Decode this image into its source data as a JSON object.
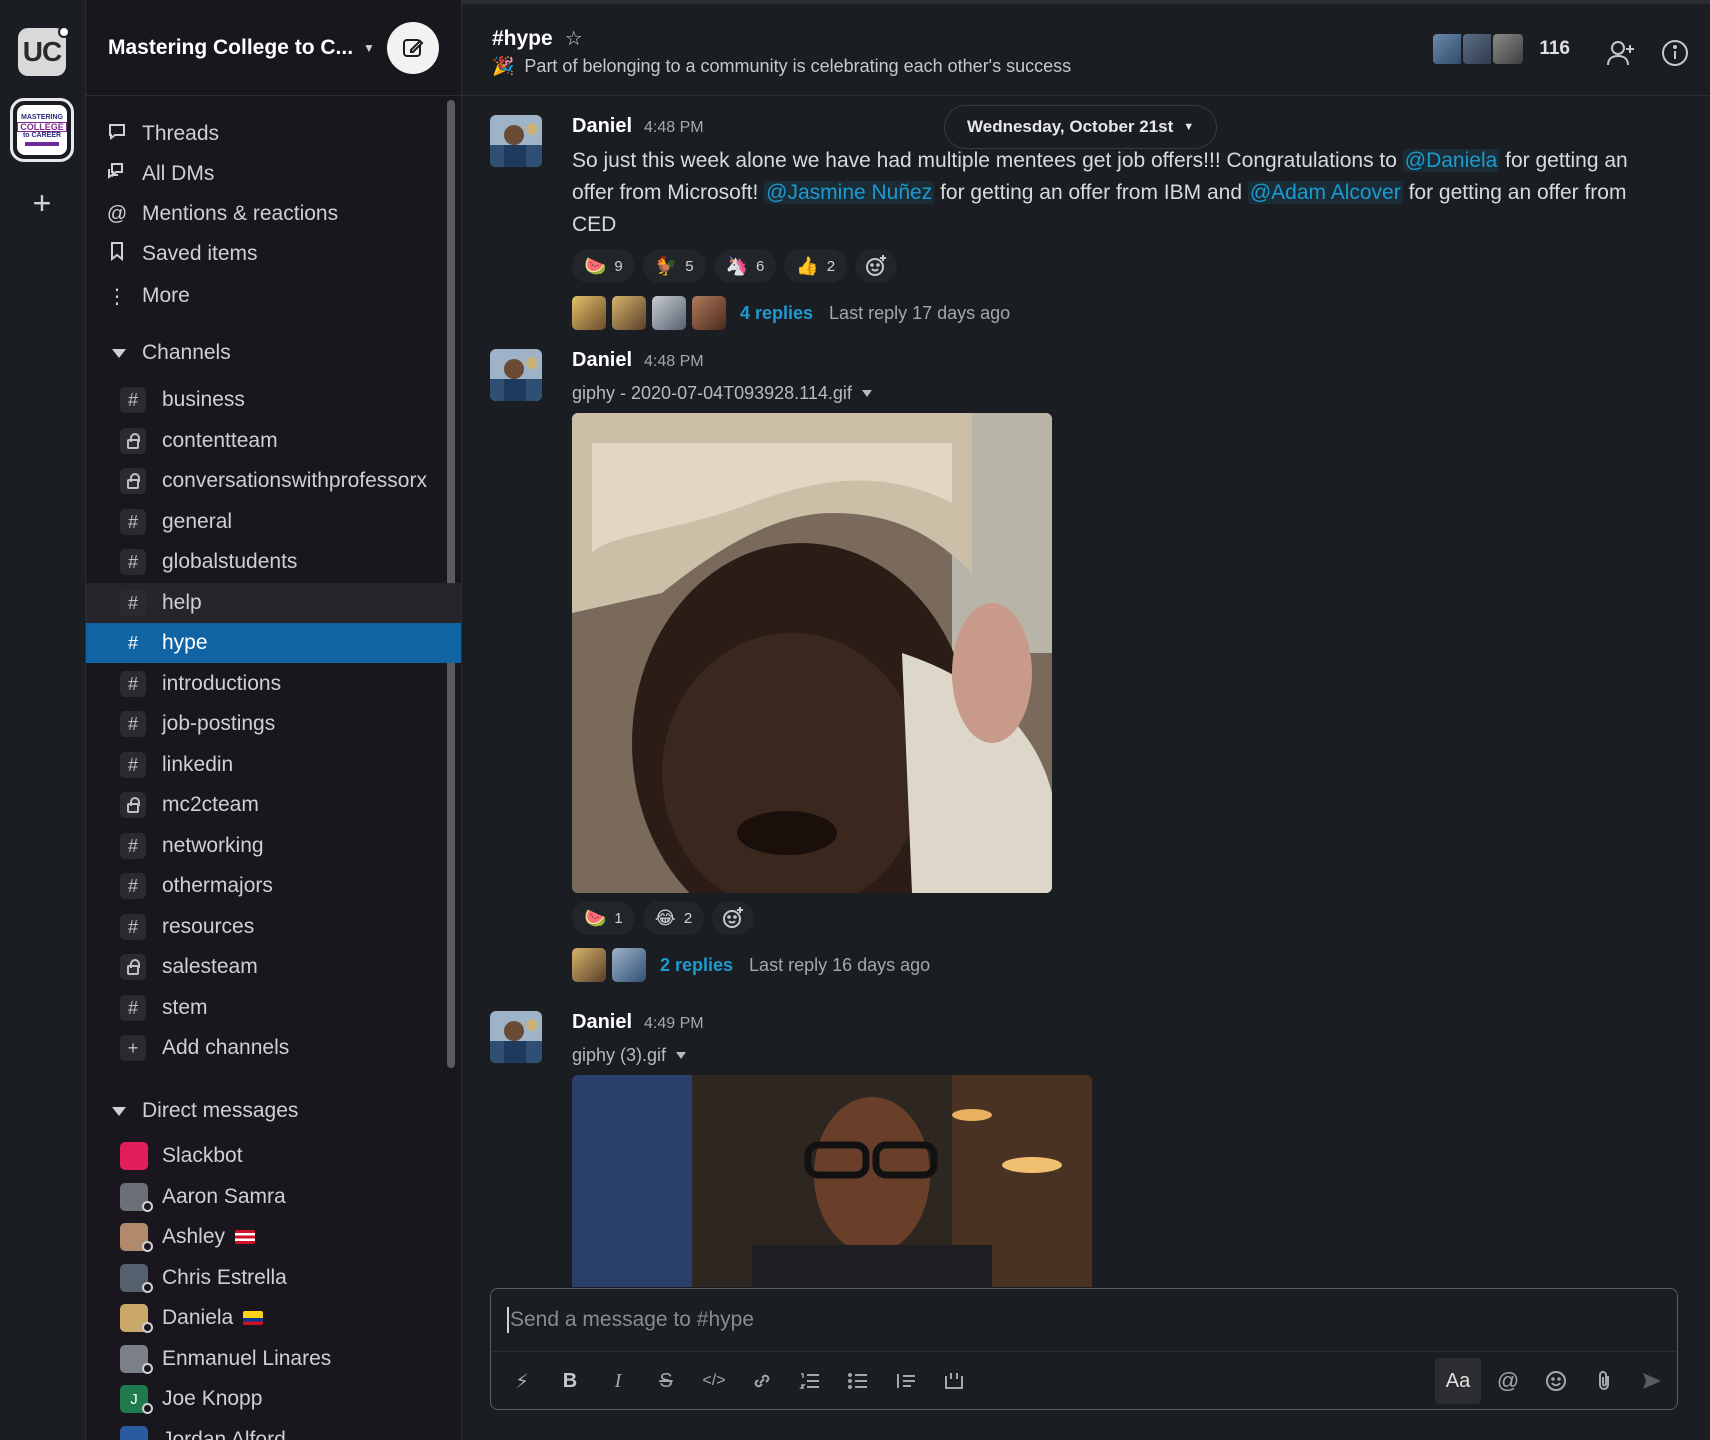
{
  "workspace_rail": {
    "primary_initials": "UC",
    "secondary_logo_lines": [
      "MASTERING",
      "COLLEGE",
      "to CAREER"
    ],
    "add_label": "+"
  },
  "sidebar": {
    "workspace_name": "Mastering College to C...",
    "nav": [
      {
        "label": "Threads",
        "icon": "threads-icon"
      },
      {
        "label": "All DMs",
        "icon": "dms-icon"
      },
      {
        "label": "Mentions & reactions",
        "icon": "at-icon"
      },
      {
        "label": "Saved items",
        "icon": "bookmark-icon"
      },
      {
        "label": "More",
        "icon": "more-vertical-icon"
      }
    ],
    "channels_header": "Channels",
    "channels": [
      {
        "name": "business",
        "private": false
      },
      {
        "name": "contentteam",
        "private": true
      },
      {
        "name": "conversationswithprofessorx",
        "private": true
      },
      {
        "name": "general",
        "private": false
      },
      {
        "name": "globalstudents",
        "private": false
      },
      {
        "name": "help",
        "private": false
      },
      {
        "name": "hype",
        "private": false
      },
      {
        "name": "introductions",
        "private": false
      },
      {
        "name": "job-postings",
        "private": false
      },
      {
        "name": "linkedin",
        "private": false
      },
      {
        "name": "mc2cteam",
        "private": true
      },
      {
        "name": "networking",
        "private": false
      },
      {
        "name": "othermajors",
        "private": false
      },
      {
        "name": "resources",
        "private": false
      },
      {
        "name": "salesteam",
        "private": true
      },
      {
        "name": "stem",
        "private": false
      }
    ],
    "add_channels": "Add channels",
    "dm_header": "Direct messages",
    "dms": [
      {
        "name": "Slackbot",
        "color": "#e01e5a"
      },
      {
        "name": "Aaron Samra",
        "color": "#6b6f78"
      },
      {
        "name": "Ashley",
        "color": "#b08a6a"
      },
      {
        "name": "Chris Estrella",
        "color": "#55606e"
      },
      {
        "name": "Daniela",
        "color": "#c9a86a"
      },
      {
        "name": "Enmanuel Linares",
        "color": "#7a7f88"
      },
      {
        "name": "Joe Knopp",
        "color": "#1f7a4d",
        "initial": "J"
      },
      {
        "name": "Jordan Alford",
        "color": "#2b5a9e"
      }
    ]
  },
  "header": {
    "channel": "#hype",
    "topic_emoji": "🎉",
    "topic": "Part of belonging to a community is celebrating each other's success",
    "member_count": "116"
  },
  "date_divider": "Wednesday, October 21st",
  "messages": [
    {
      "author": "Daniel",
      "time": "4:48 PM",
      "text_parts": [
        "So just this week alone we have had multiple mentees get job offers!!!  Congratulations to ",
        "@Daniela",
        " for getting an offer from Microsoft! ",
        "@Jasmine Nuñez",
        " for getting an offer from IBM and ",
        "@Adam Alcover",
        " for getting an offer from CED"
      ],
      "reactions": [
        {
          "emoji": "🍉",
          "count": "9"
        },
        {
          "emoji": "🐓",
          "count": "5"
        },
        {
          "emoji": "🦄",
          "count": "6"
        },
        {
          "emoji": "👍",
          "count": "2"
        }
      ],
      "thread": {
        "replies": "4 replies",
        "last": "Last reply 17 days ago"
      }
    },
    {
      "author": "Daniel",
      "time": "4:48 PM",
      "filename": "giphy - 2020-07-04T093928.114.gif",
      "reactions": [
        {
          "emoji": "🍉",
          "count": "1"
        },
        {
          "emoji": "😂",
          "count": "2"
        }
      ],
      "thread": {
        "replies": "2 replies",
        "last": "Last reply 16 days ago"
      }
    },
    {
      "author": "Daniel",
      "time": "4:49 PM",
      "filename": "giphy (3).gif"
    }
  ],
  "composer": {
    "placeholder": "Send a message to #hype",
    "format_label": "Aa"
  },
  "colors": {
    "accent": "#1164a3",
    "mention": "#1d9bd1",
    "sidebar_bg": "#19171d",
    "main_bg": "#1a1d21"
  }
}
